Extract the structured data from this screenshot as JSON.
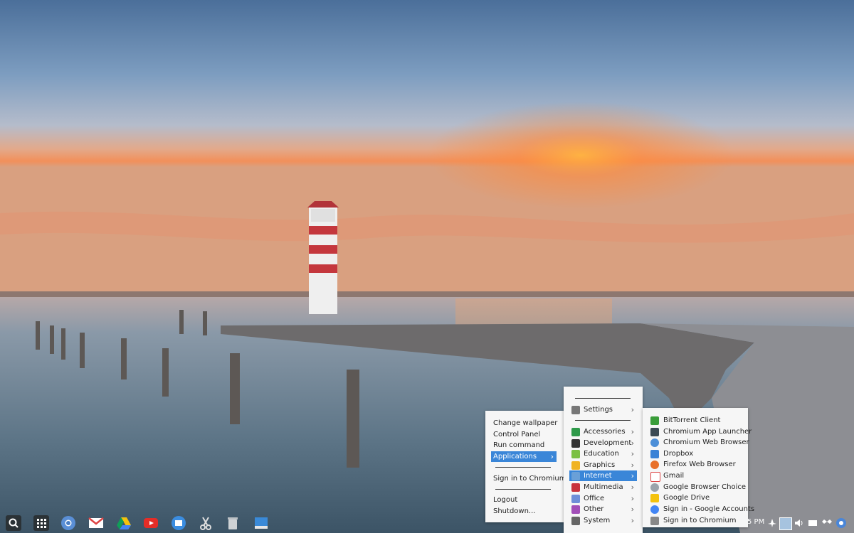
{
  "context_menu": {
    "items": [
      {
        "label": "Change wallpaper"
      },
      {
        "label": "Control Panel"
      },
      {
        "label": "Run command"
      },
      {
        "label": "Applications",
        "highlighted": true,
        "submenu": true
      },
      {
        "label": "Sign in to Chromium"
      },
      {
        "label": "Logout"
      },
      {
        "label": "Shutdown..."
      }
    ]
  },
  "applications_menu": {
    "items": [
      {
        "label": "Settings",
        "icon": "settings-icon"
      },
      {
        "label": "Accessories",
        "icon": "accessories-icon"
      },
      {
        "label": "Development",
        "icon": "development-icon"
      },
      {
        "label": "Education",
        "icon": "education-icon"
      },
      {
        "label": "Graphics",
        "icon": "graphics-icon"
      },
      {
        "label": "Internet",
        "icon": "internet-icon",
        "highlighted": true
      },
      {
        "label": "Multimedia",
        "icon": "multimedia-icon"
      },
      {
        "label": "Office",
        "icon": "office-icon"
      },
      {
        "label": "Other",
        "icon": "other-icon"
      },
      {
        "label": "System",
        "icon": "system-icon"
      }
    ],
    "chevron": "›"
  },
  "internet_menu": {
    "items": [
      {
        "label": "BitTorrent Client",
        "icon": "bittorrent-icon"
      },
      {
        "label": "Chromium App Launcher",
        "icon": "app-launcher-icon"
      },
      {
        "label": "Chromium Web Browser",
        "icon": "chromium-icon"
      },
      {
        "label": "Dropbox",
        "icon": "dropbox-icon"
      },
      {
        "label": "Firefox Web Browser",
        "icon": "firefox-icon"
      },
      {
        "label": "Gmail",
        "icon": "gmail-icon"
      },
      {
        "label": "Google Browser Choice",
        "icon": "browser-choice-icon"
      },
      {
        "label": "Google Drive",
        "icon": "google-drive-icon"
      },
      {
        "label": "Sign in - Google Accounts",
        "icon": "google-accounts-icon"
      },
      {
        "label": "Sign in to Chromium",
        "icon": "sign-in-chromium-icon"
      }
    ]
  },
  "shelf": {
    "apps": [
      {
        "name": "search-icon"
      },
      {
        "name": "app-launcher-icon"
      },
      {
        "name": "chromium-icon"
      },
      {
        "name": "gmail-icon"
      },
      {
        "name": "google-drive-icon"
      },
      {
        "name": "youtube-icon"
      },
      {
        "name": "files-icon"
      },
      {
        "name": "scissors-icon"
      },
      {
        "name": "trash-icon"
      },
      {
        "name": "window-icon"
      }
    ],
    "clock": "5 PM",
    "tray": [
      "network-icon",
      "user-avatar-icon",
      "volume-icon",
      "keyboard-icon",
      "dropbox-icon",
      "chromium-icon"
    ]
  },
  "colors": {
    "highlight": "#3a86d8",
    "menu_bg": "#f6f6f6",
    "shelf_bg": "#2a3136"
  }
}
